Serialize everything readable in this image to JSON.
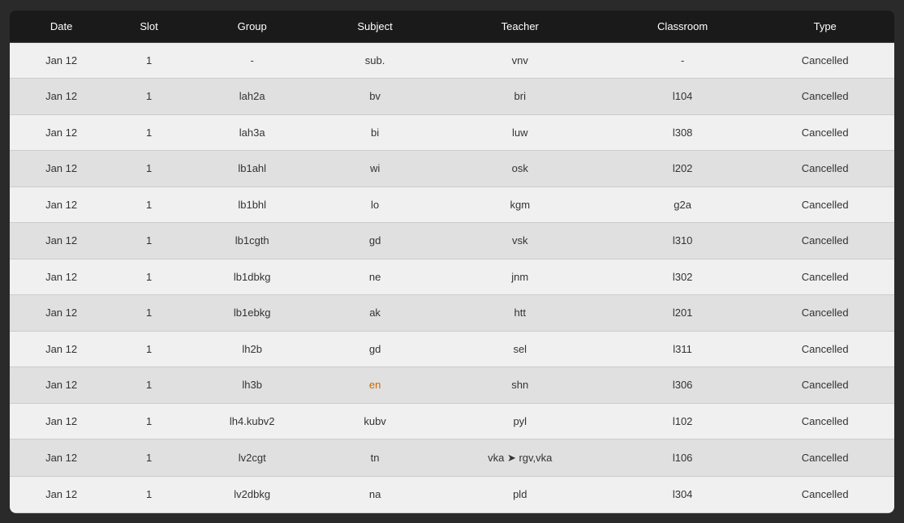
{
  "table": {
    "headers": [
      "Date",
      "Slot",
      "Group",
      "Subject",
      "Teacher",
      "Classroom",
      "Type"
    ],
    "rows": [
      {
        "date": "Jan 12",
        "slot": "1",
        "group": "-",
        "subject": "sub.",
        "teacher": "vnv",
        "classroom": "-",
        "type": "Cancelled"
      },
      {
        "date": "Jan 12",
        "slot": "1",
        "group": "lah2a",
        "subject": "bv",
        "teacher": "bri",
        "classroom": "l104",
        "type": "Cancelled"
      },
      {
        "date": "Jan 12",
        "slot": "1",
        "group": "lah3a",
        "subject": "bi",
        "teacher": "luw",
        "classroom": "l308",
        "type": "Cancelled"
      },
      {
        "date": "Jan 12",
        "slot": "1",
        "group": "lb1ahl",
        "subject": "wi",
        "teacher": "osk",
        "classroom": "l202",
        "type": "Cancelled"
      },
      {
        "date": "Jan 12",
        "slot": "1",
        "group": "lb1bhl",
        "subject": "lo",
        "teacher": "kgm",
        "classroom": "g2a",
        "type": "Cancelled"
      },
      {
        "date": "Jan 12",
        "slot": "1",
        "group": "lb1cgth",
        "subject": "gd",
        "teacher": "vsk",
        "classroom": "l310",
        "type": "Cancelled"
      },
      {
        "date": "Jan 12",
        "slot": "1",
        "group": "lb1dbkg",
        "subject": "ne",
        "teacher": "jnm",
        "classroom": "l302",
        "type": "Cancelled"
      },
      {
        "date": "Jan 12",
        "slot": "1",
        "group": "lb1ebkg",
        "subject": "ak",
        "teacher": "htt",
        "classroom": "l201",
        "type": "Cancelled"
      },
      {
        "date": "Jan 12",
        "slot": "1",
        "group": "lh2b",
        "subject": "gd",
        "teacher": "sel",
        "classroom": "l311",
        "type": "Cancelled"
      },
      {
        "date": "Jan 12",
        "slot": "1",
        "group": "lh3b",
        "subject": "en",
        "teacher": "shn",
        "classroom": "l306",
        "type": "Cancelled"
      },
      {
        "date": "Jan 12",
        "slot": "1",
        "group": "lh4.kubv2",
        "subject": "kubv",
        "teacher": "pyl",
        "classroom": "l102",
        "type": "Cancelled"
      },
      {
        "date": "Jan 12",
        "slot": "1",
        "group": "lv2cgt",
        "subject": "tn",
        "teacher": "vka ➤ rgv,vka",
        "classroom": "l106",
        "type": "Cancelled"
      },
      {
        "date": "Jan 12",
        "slot": "1",
        "group": "lv2dbkg",
        "subject": "na",
        "teacher": "pld",
        "classroom": "l304",
        "type": "Cancelled"
      }
    ]
  }
}
